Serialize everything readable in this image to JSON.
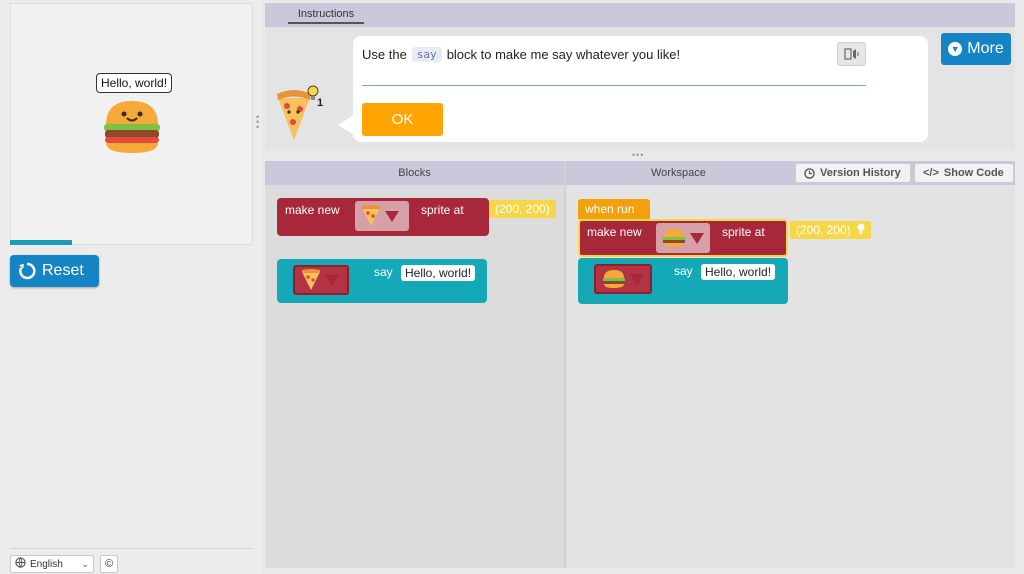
{
  "stage": {
    "speech_text": "Hello, world!",
    "reset_label": "Reset"
  },
  "footer": {
    "language": "English",
    "copyright_symbol": "©"
  },
  "instructions": {
    "tab_label": "Instructions",
    "text_before": "Use the",
    "code_chip": "say",
    "text_after": "block to make me say whatever you like!",
    "hint_count": "1",
    "ok_label": "OK",
    "more_label": "More"
  },
  "blocks_panel": {
    "header": "Blocks",
    "make_new_block": {
      "prefix": "make new",
      "suffix": "sprite at",
      "coords": "(200, 200)"
    },
    "say_block": {
      "label": "say",
      "text": "Hello, world!"
    }
  },
  "workspace_panel": {
    "header": "Workspace",
    "version_history_label": "Version History",
    "show_code_label": "Show Code",
    "when_run_label": "when run",
    "make_new_block": {
      "prefix": "make new",
      "suffix": "sprite at",
      "coords": "(200, 200)"
    },
    "say_block": {
      "label": "say",
      "text": "Hello, world!"
    }
  },
  "colors": {
    "primary_blue": "#1584c4",
    "ok_orange": "#ffa400",
    "header_purple": "#cdc7db",
    "block_red": "#a7283a",
    "block_teal": "#15a9b8",
    "block_orange": "#f2a10c",
    "field_yellow": "#f7d748"
  },
  "icons": {
    "reset": "reset-icon",
    "more": "chevron-circle-down-icon",
    "speaker": "speaker-icon",
    "globe": "globe-icon",
    "clock": "clock-icon",
    "code": "code-icon",
    "lightbulb": "lightbulb-icon"
  }
}
